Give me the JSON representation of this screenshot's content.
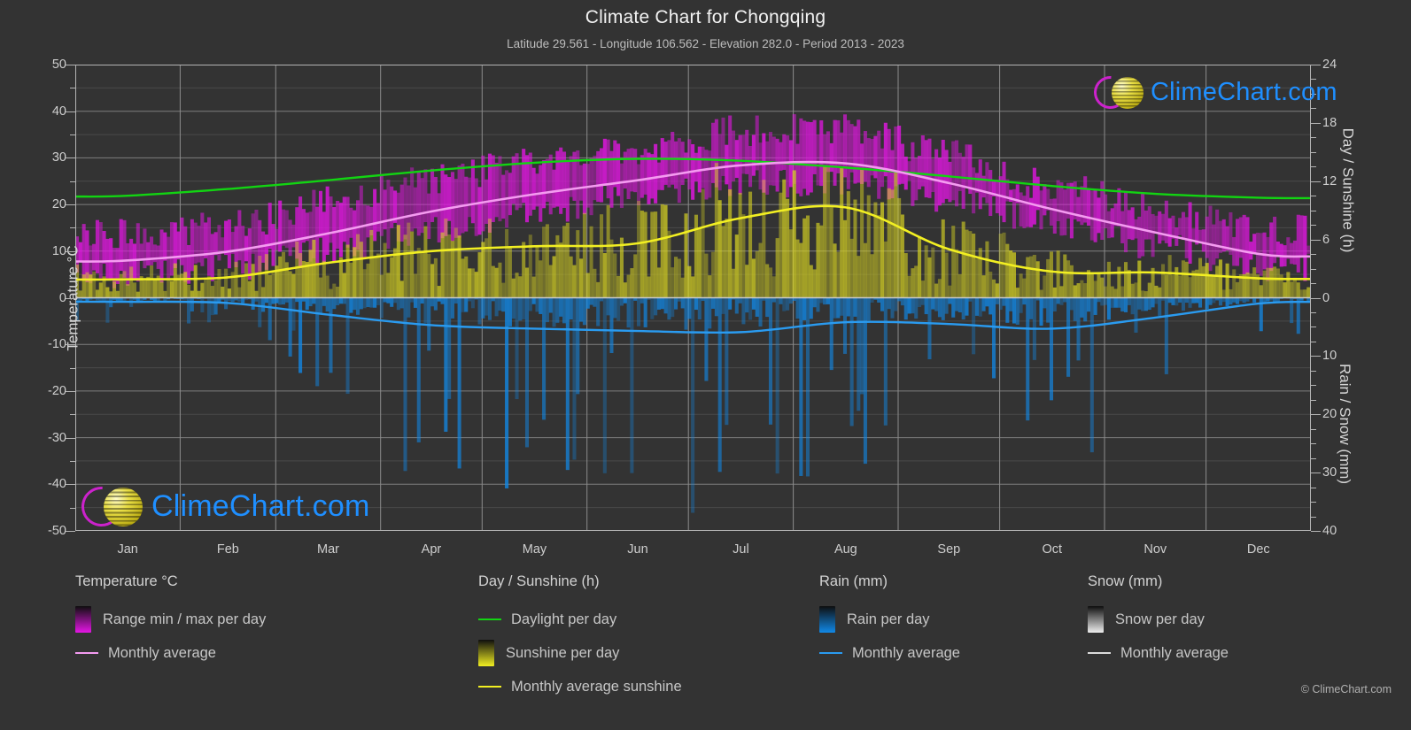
{
  "header": {
    "title": "Climate Chart for Chongqing",
    "subtitle": "Latitude 29.561 - Longitude 106.562 - Elevation 282.0 - Period 2013 - 2023"
  },
  "branding": {
    "logo_text": "ClimeChart.com",
    "copyright": "© ClimeChart.com",
    "logo_ring_color": "#cc22cc",
    "logo_ball_color": "#d6cc22",
    "logo_text_color": "#1f8fff"
  },
  "axes": {
    "left": {
      "label": "Temperature °C",
      "ticks": [
        "50",
        "40",
        "30",
        "20",
        "10",
        "0",
        "-10",
        "-20",
        "-30",
        "-40",
        "-50"
      ],
      "min": -50,
      "max": 50,
      "step": 10,
      "minor_step": 5
    },
    "right_top": {
      "label": "Day / Sunshine (h)",
      "ticks": [
        "24",
        "18",
        "12",
        "6",
        "0"
      ],
      "min": 0,
      "max": 24,
      "step": 6
    },
    "right_bottom": {
      "label": "Rain / Snow (mm)",
      "ticks": [
        "0",
        "10",
        "20",
        "30",
        "40"
      ],
      "min": 0,
      "max": 40,
      "step": 10
    },
    "x": {
      "ticks": [
        "Jan",
        "Feb",
        "Mar",
        "Apr",
        "May",
        "Jun",
        "Jul",
        "Aug",
        "Sep",
        "Oct",
        "Nov",
        "Dec"
      ]
    }
  },
  "legend": {
    "columns": [
      {
        "title": "Temperature °C",
        "items": [
          {
            "label": "Range min / max per day",
            "kind": "swatch",
            "color": "#e516e5"
          },
          {
            "label": "Monthly average",
            "kind": "line",
            "color": "#f49bf0"
          }
        ]
      },
      {
        "title": "Day / Sunshine (h)",
        "items": [
          {
            "label": "Daylight per day",
            "kind": "line",
            "color": "#12d412"
          },
          {
            "label": "Sunshine per day",
            "kind": "swatch",
            "color": "#f2ef22"
          },
          {
            "label": "Monthly average sunshine",
            "kind": "line",
            "color": "#f2ef22"
          }
        ]
      },
      {
        "title": "Rain (mm)",
        "items": [
          {
            "label": "Rain per day",
            "kind": "swatch",
            "color": "#1189e8"
          },
          {
            "label": "Monthly average",
            "kind": "line",
            "color": "#2a9bf0"
          }
        ]
      },
      {
        "title": "Snow (mm)",
        "items": [
          {
            "label": "Snow per day",
            "kind": "swatch",
            "color": "#efefef"
          },
          {
            "label": "Monthly average",
            "kind": "line",
            "color": "#dcdcdc"
          }
        ]
      }
    ]
  },
  "chart_data": {
    "type": "area",
    "title": "Climate Chart for Chongqing",
    "subtitle": "Latitude 29.561 - Longitude 106.562 - Elevation 282.0 - Period 2013 - 2023",
    "xlabel": "",
    "ylabel": "Temperature °C",
    "ylim": [
      -50,
      50
    ],
    "y2_top_label": "Day / Sunshine (h)",
    "y2_top_lim": [
      0,
      24
    ],
    "y2_bottom_label": "Rain / Snow (mm)",
    "y2_bottom_lim": [
      0,
      40
    ],
    "grid": true,
    "legend_position": "below",
    "categories": [
      "Jan",
      "Feb",
      "Mar",
      "Apr",
      "May",
      "Jun",
      "Jul",
      "Aug",
      "Sep",
      "Oct",
      "Nov",
      "Dec"
    ],
    "series": [
      {
        "name": "Monthly average temperature",
        "unit": "°C",
        "axis": "left",
        "color": "#f49bf0",
        "values": [
          8.0,
          9.9,
          13.8,
          18.5,
          22.2,
          25.2,
          28.4,
          28.8,
          24.6,
          19.0,
          14.0,
          9.4
        ]
      },
      {
        "name": "Daily maximum temperature (range top)",
        "unit": "°C",
        "axis": "left",
        "color": "#e516e5",
        "values": [
          13.5,
          15.5,
          20.5,
          25.5,
          29.0,
          32.0,
          36.0,
          36.5,
          30.5,
          24.0,
          19.0,
          14.5
        ]
      },
      {
        "name": "Daily minimum temperature (range bottom)",
        "unit": "°C",
        "axis": "left",
        "color": "#e516e5",
        "values": [
          5.0,
          6.5,
          10.0,
          14.5,
          18.5,
          22.0,
          24.5,
          24.5,
          21.0,
          16.0,
          11.0,
          6.5
        ]
      },
      {
        "name": "Daylight per day",
        "unit": "h",
        "axis": "right_top",
        "color": "#12d412",
        "values": [
          10.5,
          11.2,
          12.1,
          13.1,
          13.9,
          14.3,
          14.1,
          13.4,
          12.5,
          11.5,
          10.7,
          10.3
        ]
      },
      {
        "name": "Monthly average sunshine",
        "unit": "h",
        "axis": "right_top",
        "color": "#f2ef22",
        "values": [
          1.9,
          2.1,
          3.6,
          4.8,
          5.3,
          5.6,
          8.2,
          9.3,
          5.0,
          2.7,
          2.6,
          2.0
        ]
      },
      {
        "name": "Monthly average rain",
        "unit": "mm",
        "axis": "right_bottom",
        "color": "#2a9bf0",
        "values": [
          0.7,
          0.9,
          2.9,
          4.7,
          5.3,
          5.7,
          5.9,
          4.2,
          4.5,
          5.3,
          3.4,
          1.0
        ]
      },
      {
        "name": "Monthly average snow",
        "unit": "mm",
        "axis": "right_bottom",
        "color": "#dcdcdc",
        "values": [
          0,
          0,
          0,
          0,
          0,
          0,
          0,
          0,
          0,
          0,
          0,
          0
        ]
      }
    ]
  }
}
